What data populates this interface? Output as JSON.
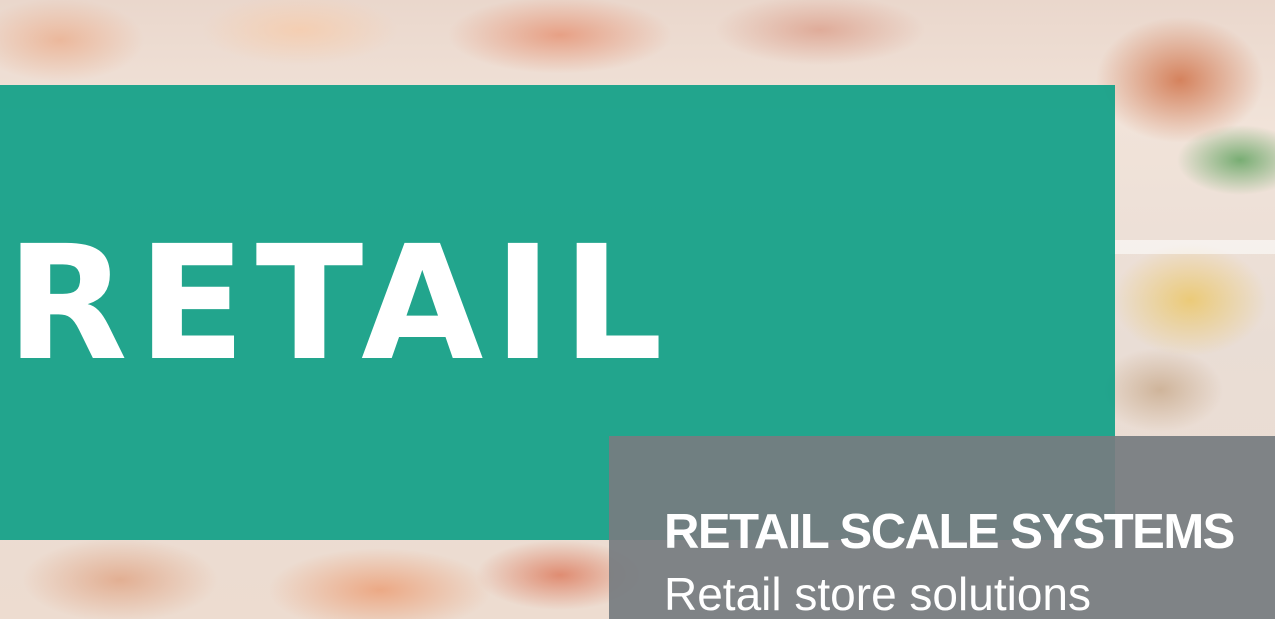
{
  "hero": {
    "main_title": "RETAIL",
    "card_title": "RETAIL SCALE SYSTEMS",
    "card_subtitle": "Retail store solutions"
  },
  "colors": {
    "teal_panel": "#12a088",
    "grey_panel": "#767c80",
    "text": "#ffffff"
  }
}
